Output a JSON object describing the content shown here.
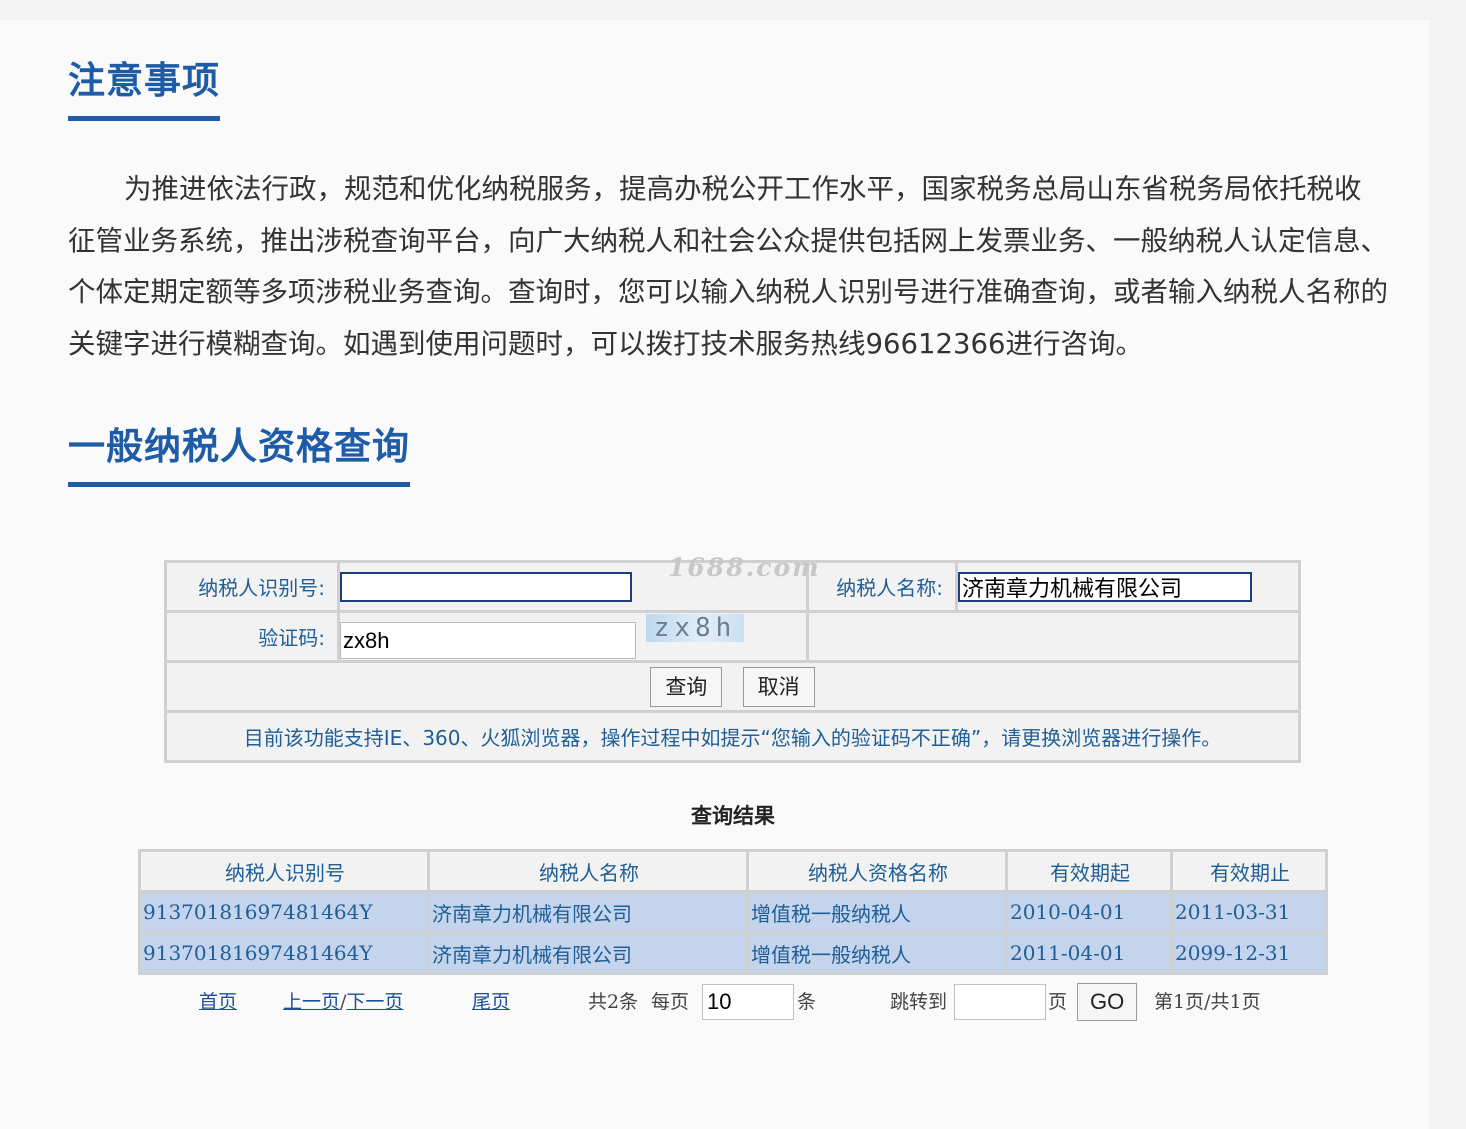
{
  "notice": {
    "title": "注意事项",
    "text": "为推进依法行政，规范和优化纳税服务，提高办税公开工作水平，国家税务总局山东省税务局依托税收征管业务系统，推出涉税查询平台，向广大纳税人和社会公众提供包括网上发票业务、一般纳税人认定信息、个体定期定额等多项涉税业务查询。查询时，您可以输入纳税人识别号进行准确查询，或者输入纳税人名称的关键字进行模糊查询。如遇到使用问题时，可以拨打技术服务热线96612366进行咨询。"
  },
  "query": {
    "title": "一般纳税人资格查询",
    "watermark": "1688.com",
    "taxpayer_id_label": "纳税人识别号:",
    "taxpayer_id_value": "",
    "taxpayer_name_label": "纳税人名称:",
    "taxpayer_name_value": "济南章力机械有限公司",
    "captcha_label": "验证码:",
    "captcha_value": "zx8h",
    "captcha_image_text": "zx8h",
    "submit_label": "查询",
    "cancel_label": "取消",
    "tip": "目前该功能支持IE、360、火狐浏览器，操作过程中如提示“您输入的验证码不正确”，请更换浏览器进行操作。"
  },
  "result": {
    "caption": "查询结果",
    "columns": [
      "纳税人识别号",
      "纳税人名称",
      "纳税人资格名称",
      "有效期起",
      "有效期止"
    ],
    "rows": [
      [
        "91370181697481464Y",
        "济南章力机械有限公司",
        "增值税一般纳税人",
        "2010-04-01",
        "2011-03-31"
      ],
      [
        "91370181697481464Y",
        "济南章力机械有限公司",
        "增值税一般纳税人",
        "2011-04-01",
        "2099-12-31"
      ]
    ]
  },
  "pager": {
    "first": "首页",
    "prev": "上一页",
    "separator": "/",
    "next": "下一页",
    "last": "尾页",
    "total": "共2条",
    "per_page_label": "每页",
    "per_page_value": "10",
    "per_page_unit": "条",
    "jump_label": "跳转到",
    "jump_value": "",
    "page_unit": "页",
    "go_label": "GO",
    "status": "第1页/共1页"
  },
  "colors": {
    "title_blue": "#1e5ca8",
    "link_blue": "#1f5e96",
    "row_bg": "#c3d4ec",
    "border_gray": "#d0d0d0"
  }
}
